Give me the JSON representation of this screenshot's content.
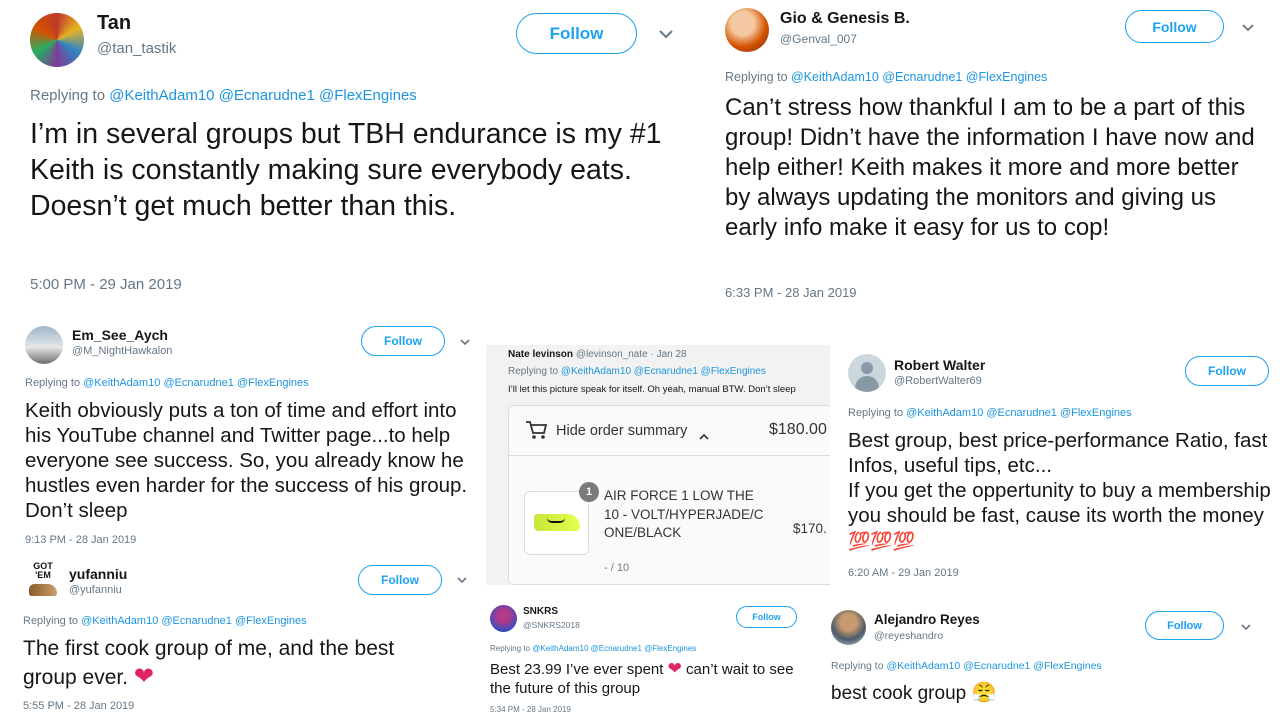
{
  "reply_prefix": "Replying to",
  "mentions": [
    "@KeithAdam10",
    "@Ecnarudne1",
    "@FlexEngines"
  ],
  "follow_label": "Follow",
  "tweets": [
    {
      "name": "Tan",
      "handle": "@tan_tastik",
      "text": "I’m in several groups but TBH endurance is my #1  Keith is constantly making sure everybody eats. Doesn’t get much better than this.",
      "time": "5:00 PM - 29 Jan 2019"
    },
    {
      "name": "Gio & Genesis B.",
      "handle": "@Genval_007",
      "text": "Can’t stress how thankful I am to be a part of this group! Didn’t have the information I have now and help either! Keith makes it more and more better by always updating the monitors and giving us early info make it easy for us to cop!",
      "time": "6:33 PM - 28 Jan 2019"
    },
    {
      "name": "Em_See_Aych",
      "handle": "@M_NightHawkalon",
      "text": "Keith obviously puts a ton of time and effort into his YouTube channel and Twitter page...to help everyone see success. So, you already know he hustles even harder for the success of his group. Don’t sleep",
      "time": "9:13 PM - 28 Jan 2019"
    },
    {
      "name": "yufanniu",
      "handle": "@yufanniu",
      "text": "The first cook group of me, and the best group ever.",
      "emoji": "❤",
      "time": "5:55 PM - 28 Jan 2019",
      "avatar_text": "GOT EM"
    },
    {
      "name": "Nate levinson",
      "handle": "@levinson_nate",
      "date": "· Jan 28",
      "text": "I’ll let this picture speak for itself. Oh yeah, manual BTW. Don’t sleep",
      "order": {
        "toggle": "Hide order summary",
        "total": "$180.00",
        "quantity": "1",
        "item_name": "AIR FORCE 1 LOW THE 10 - VOLT/HYPERJADE/CONE/BLACK",
        "item_price": "$170.",
        "item_size": "- / 10"
      }
    },
    {
      "name": "Robert Walter",
      "handle": "@RobertWalter69",
      "text": "Best group, best price-performance Ratio, fast Infos, useful tips, etc...\nIf you get the oppertunity to buy a membership you should be fast, cause its worth the money",
      "emoji": "💯💯💯",
      "time": "6:20 AM - 29 Jan 2019"
    },
    {
      "name": "SNKRS",
      "handle": "@SNKRS2018",
      "text_a": "Best 23.99 I’ve ever spent",
      "emoji": "❤",
      "text_b": "can’t wait to see the future of this group",
      "time": "5:34 PM - 28 Jan 2019"
    },
    {
      "name": "Alejandro Reyes",
      "handle": "@reyeshandro",
      "text": "best cook group",
      "emoji": "😤"
    }
  ],
  "colors": {
    "accent": "#1da1f2",
    "mention": "#1b95e0",
    "muted": "#657786",
    "heart": "#e0245e"
  }
}
